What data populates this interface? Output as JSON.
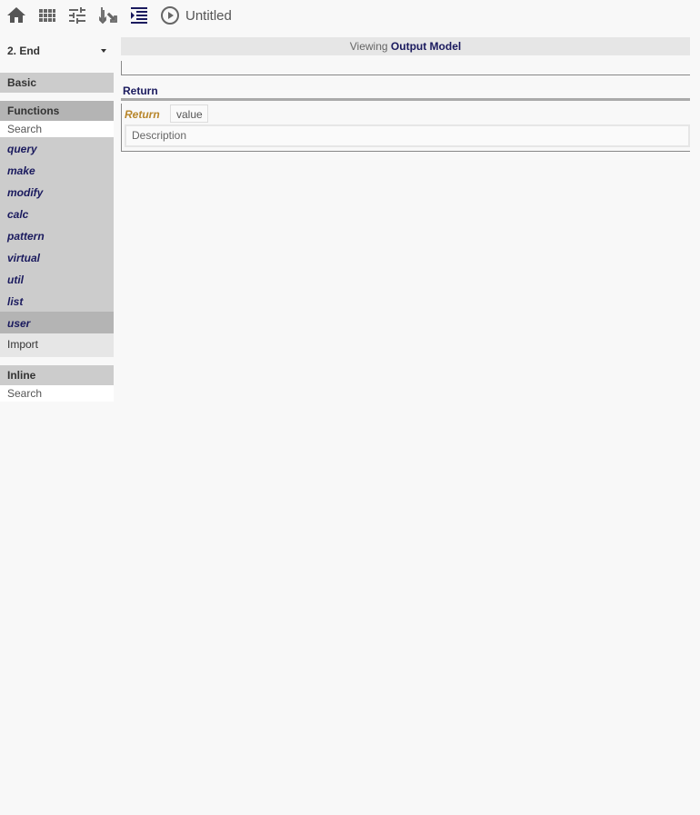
{
  "toolbar": {
    "icons": [
      "home-icon",
      "grid-icon",
      "tune-icon",
      "merge-icon",
      "format-indent-icon",
      "play-circle-icon"
    ],
    "doc_title": "Untitled"
  },
  "sidebar": {
    "step_select": "2. End",
    "basic_label": "Basic",
    "functions_label": "Functions",
    "functions_search_placeholder": "Search",
    "functions": [
      "query",
      "make",
      "modify",
      "calc",
      "pattern",
      "virtual",
      "util",
      "list",
      "user"
    ],
    "active_function": "user",
    "import_label": "Import",
    "inline_label": "Inline",
    "inline_search_placeholder": "Search"
  },
  "main": {
    "viewing_prefix": "Viewing",
    "viewing_target": "Output Model",
    "return_title": "Return",
    "return_label": "Return",
    "return_value": "value",
    "description_placeholder": "Description"
  },
  "colors": {
    "accent": "#1a1a5e",
    "return_label": "#b8862b",
    "sidebar_bg": "#cccccc",
    "sidebar_active": "#b4b4b4"
  }
}
